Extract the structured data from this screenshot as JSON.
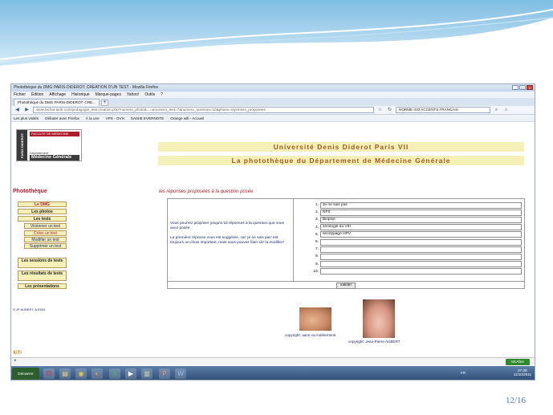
{
  "slide": {
    "page_number": "12/16"
  },
  "browser": {
    "window_title": "Photothèque du DMG PARIS-DIDEROT: CREATION D'UN TEST - Mozilla Firefox",
    "menu": [
      "Fichier",
      "Édition",
      "Affichage",
      "Historique",
      "Marque-pages",
      "Yahoo!",
      "Outils",
      "?"
    ],
    "tab_label": "Photothèque du DMG PARIS-DIDEROT: CRE...",
    "url": "www.bichat-larib.com/pedagogie_test.creation.php?numero_photo&...=&numero_test=7&numero_question=10&phase=reponses_proposees",
    "search_text": "NORME ISO ACCENTS FRANCAIS",
    "bookmarks": [
      "Les plus visités",
      "Débuter avec Firefox",
      "À la une",
      "VPS - OVH",
      "SAISIE EVERNOTE",
      "Orange wifi - Accueil"
    ]
  },
  "site": {
    "logo": {
      "side": "PARIS DIDEROT",
      "top": "FACULTE DE MEDECINE",
      "small": "Département",
      "big": "Médecine Générale"
    },
    "banner_university": "Université Denis Diderot Paris VII",
    "banner_dept": "La photothèque du Département de Médecine Générale",
    "sidebar": {
      "title": "Photothèque",
      "items": [
        "Le DMG",
        "Les photos",
        "Les tests",
        "Visionner un test",
        "Créer un test",
        "Modifier un test",
        "Supprimer un test",
        "Les sessions de tests",
        "Les résultats de tests",
        "Les présentations"
      ],
      "credit": "© JP AUBERT, A EDDI"
    },
    "section_title": "les réponses proposées à la question posée",
    "form": {
      "intro": "Vous pourrez proposer jusqu'à 10 réponses à la question que vous avez posée",
      "note": "La première réponse vous est suggérée, car 'je ne sais pas' est toujours un choix important, mais vous pouvez bien sûr la modifier!",
      "answers": [
        {
          "num": "1.",
          "value": "Je ne sais pas"
        },
        {
          "num": "2.",
          "value": "NFS"
        },
        {
          "num": "3.",
          "value": "Biopsie"
        },
        {
          "num": "4.",
          "value": "sérologie du VIH"
        },
        {
          "num": "5.",
          "value": "sérotypage HPV"
        },
        {
          "num": "6.",
          "value": ""
        },
        {
          "num": "7.",
          "value": ""
        },
        {
          "num": "8.",
          "value": ""
        },
        {
          "num": "9.",
          "value": ""
        },
        {
          "num": "10.",
          "value": ""
        }
      ],
      "submit": "valider"
    },
    "caption1": "copyright: autre ou indéterminé",
    "caption2": "copyright: Jean-Pierre AUBERT",
    "xiti": "XiTi"
  },
  "notification": {
    "mcafee": "McAfee"
  },
  "taskbar": {
    "start": "Démarrer",
    "lang": "FR",
    "time": "07:28",
    "date": "11/10/2011"
  }
}
